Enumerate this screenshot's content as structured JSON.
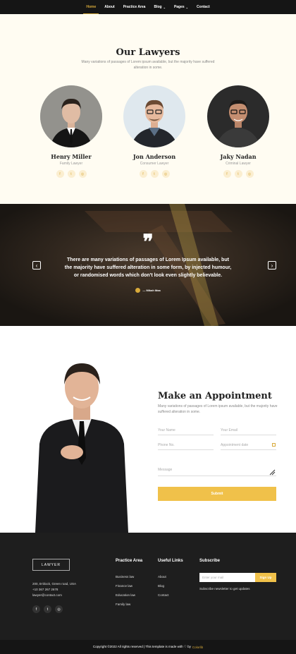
{
  "nav": {
    "items": [
      {
        "label": "Home"
      },
      {
        "label": "About"
      },
      {
        "label": "Practice Area"
      },
      {
        "label": "Blog",
        "caret": "⌄"
      },
      {
        "label": "Pages",
        "caret": "⌄"
      },
      {
        "label": "Contact"
      }
    ]
  },
  "lawyers": {
    "title": "Our Lawyers",
    "subtitle": "Many variations of passages of Lorem ipsum available, but the majority have suffered alteration in some.",
    "people": [
      {
        "name": "Henry Miller",
        "role": "Family Lawyer"
      },
      {
        "name": "Jon Anderson",
        "role": "Consumer Lawyer"
      },
      {
        "name": "Jaky Nadan",
        "role": "Criminal Lawyer"
      }
    ],
    "social_glyphs": [
      "f",
      "t",
      "◎"
    ]
  },
  "testimonial": {
    "quote_mark": "❞",
    "text": "There are many variations of passages of Lorem Ipsum available, but the majority have suffered alteration in some form, by injected humour, or randomised words which don't look even slightly believable.",
    "author": "— Mikah Maa",
    "prev": "‹",
    "next": "›"
  },
  "appointment": {
    "title": "Make an Appointment",
    "subtitle": "Many variations of passages of Lorem ipsum available, but the majority have suffered alteration in some.",
    "fields": {
      "name": "Your Name",
      "email": "Your Email",
      "phone": "Phone No.",
      "date": "Appointment date",
      "message": "Message"
    },
    "submit": "Submit"
  },
  "footer": {
    "logo": "LAWYER",
    "address": "200, B-block, Green road, USA",
    "phone": "+10 367 267 2678",
    "email": "lawyer@contact.com",
    "practice_title": "Practice Area",
    "practice_links": [
      "Business law",
      "Finance law",
      "Education law",
      "Family law"
    ],
    "useful_title": "Useful Links",
    "useful_links": [
      "About",
      "Blog",
      "Contact"
    ],
    "subscribe_title": "Subscribe",
    "email_placeholder": "Enter your mail",
    "signup": "Sign Up",
    "subscribe_note": "Subscribe newsletter to get updates",
    "social_glyphs": [
      "f",
      "t",
      "◎"
    ]
  },
  "copyright": {
    "text": "Copyright ©2022 All rights reserved | This template is made with ♡ by",
    "brand": "Colorlib"
  }
}
